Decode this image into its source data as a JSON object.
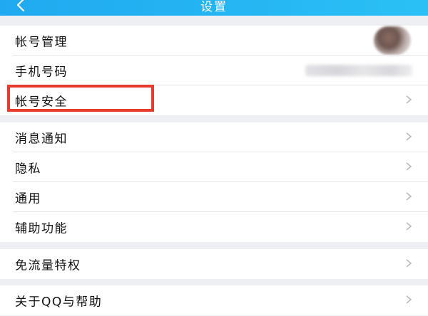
{
  "header": {
    "title": "设置",
    "back_icon": "chevron-left-icon"
  },
  "groups": [
    {
      "items": [
        {
          "label": "帐号管理",
          "trailing": "avatar"
        },
        {
          "label": "手机号码",
          "trailing": "phone-number-blurred"
        },
        {
          "label": "帐号安全",
          "trailing": "chevron",
          "highlighted": true
        }
      ]
    },
    {
      "items": [
        {
          "label": "消息通知",
          "trailing": "chevron"
        },
        {
          "label": "隐私",
          "trailing": "chevron"
        },
        {
          "label": "通用",
          "trailing": "chevron"
        },
        {
          "label": "辅助功能",
          "trailing": "chevron"
        }
      ]
    },
    {
      "items": [
        {
          "label": "免流量特权",
          "trailing": "chevron"
        }
      ]
    },
    {
      "items": [
        {
          "label": "关于QQ与帮助",
          "trailing": "chevron"
        }
      ]
    }
  ],
  "colors": {
    "header_bg": "#20a9f0",
    "background": "#eeeff3",
    "highlight_border": "#e83b30",
    "chevron": "#b8b8bd"
  }
}
